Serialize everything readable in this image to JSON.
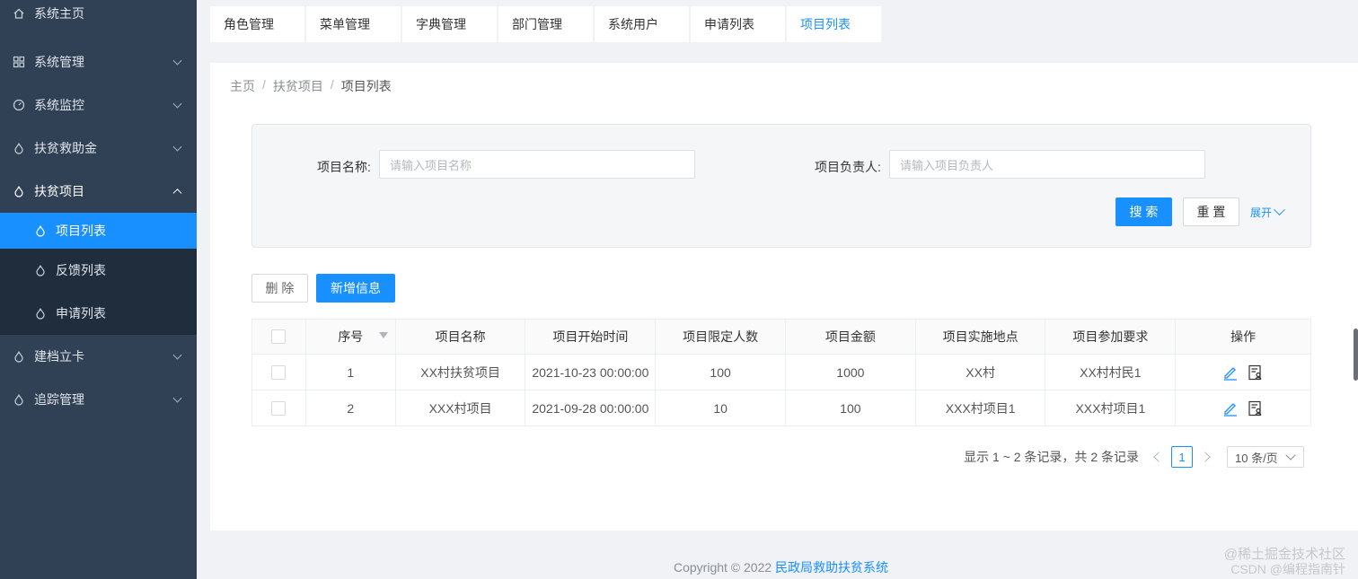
{
  "sidebar": {
    "items": [
      {
        "label": "系统主页",
        "icon": "home-icon"
      },
      {
        "label": "系统管理",
        "icon": "grid-icon"
      },
      {
        "label": "系统监控",
        "icon": "dashboard-icon"
      },
      {
        "label": "扶贫救助金",
        "icon": "drop-icon"
      },
      {
        "label": "扶贫项目",
        "icon": "drop-icon"
      },
      {
        "label": "项目列表",
        "icon": "drop-icon"
      },
      {
        "label": "反馈列表",
        "icon": "drop-icon"
      },
      {
        "label": "申请列表",
        "icon": "drop-icon"
      },
      {
        "label": "建档立卡",
        "icon": "drop-icon"
      },
      {
        "label": "追踪管理",
        "icon": "drop-icon"
      }
    ]
  },
  "tabs": [
    "角色管理",
    "菜单管理",
    "字典管理",
    "部门管理",
    "系统用户",
    "申请列表",
    "项目列表"
  ],
  "breadcrumb": {
    "home": "主页",
    "sep": "/",
    "parent": "扶贫项目",
    "current": "项目列表"
  },
  "search": {
    "name_label": "项目名称:",
    "name_placeholder": "请输入项目名称",
    "owner_label": "项目负责人:",
    "owner_placeholder": "请输入项目负责人",
    "search_btn": "搜 索",
    "reset_btn": "重 置",
    "expand": "展开"
  },
  "toolbar": {
    "delete": "删 除",
    "add": "新增信息"
  },
  "table": {
    "headers": [
      "序号",
      "项目名称",
      "项目开始时间",
      "项目限定人数",
      "项目金额",
      "项目实施地点",
      "项目参加要求",
      "操作"
    ],
    "rows": [
      [
        "1",
        "XX村扶贫项目",
        "2021-10-23 00:00:00",
        "100",
        "1000",
        "XX村",
        "XX村村民1"
      ],
      [
        "2",
        "XXX村项目",
        "2021-09-28 00:00:00",
        "10",
        "100",
        "XXX村项目1",
        "XXX村项目1"
      ]
    ]
  },
  "pagination": {
    "summary": "显示 1 ~ 2 条记录，共 2 条记录",
    "page": "1",
    "size": "10 条/页"
  },
  "footer": {
    "copyright": "Copyright © 2022 ",
    "system": "民政局救助扶贫系统"
  },
  "watermark": {
    "line1": "@稀土掘金技术社区",
    "line2": "CSDN @编程指南针"
  },
  "colors": {
    "sidebar_bg": "#304156",
    "accent": "#1890ff",
    "submenu_bg": "#1f2d3d"
  }
}
